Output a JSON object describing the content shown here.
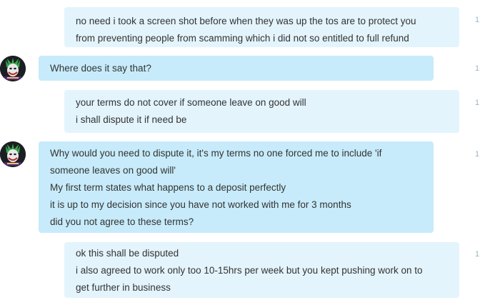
{
  "conversation": {
    "messages": [
      {
        "sender": "me",
        "lines": [
          "no need i took a screen shot before when they was up the tos are to protect you",
          "from preventing people from scamming which i did not so entitled to full refund"
        ],
        "time_stub": "1"
      },
      {
        "sender": "other",
        "avatar_icon": "joker-avatar-icon",
        "lines": [
          "Where does it say that?"
        ],
        "time_stub": "1"
      },
      {
        "sender": "me",
        "lines": [
          "your terms do not cover if someone leave on good will",
          "i shall dispute it if need be"
        ],
        "time_stub": "1"
      },
      {
        "sender": "other",
        "avatar_icon": "joker-avatar-icon",
        "lines": [
          "Why would you need to dispute it, it's my terms no one forced me to include 'if",
          "someone leaves on good will'",
          "My first term states what happens to a deposit perfectly",
          "it is up to my decision since you have not worked with me for 3 months",
          "did you not agree to these terms?"
        ],
        "time_stub": "1"
      },
      {
        "sender": "me",
        "lines": [
          "ok this shall be disputed",
          "i also agreed to work only too 10-15hrs per week but you kept pushing work on to",
          "get further in business"
        ],
        "time_stub": "1"
      }
    ]
  },
  "colors": {
    "outgoing_bubble": "#e3f4fc",
    "incoming_bubble": "#c7ebfa",
    "text": "#333333",
    "timestamp": "#9bb5c4"
  }
}
